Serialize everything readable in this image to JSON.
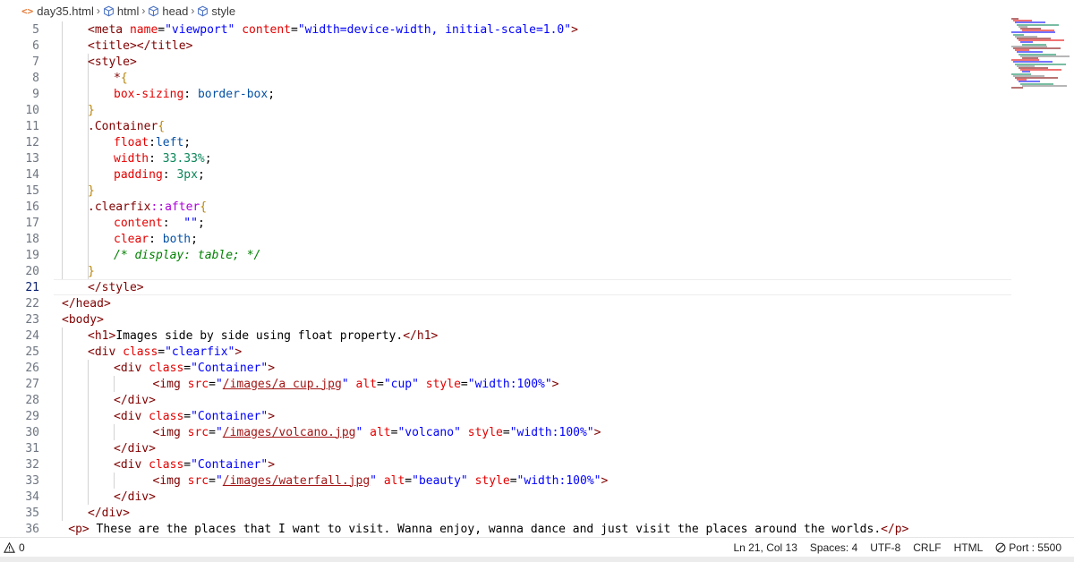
{
  "breadcrumb": {
    "file": "day35.html",
    "html": "html",
    "head": "head",
    "style": "style",
    "file_icon": "<>"
  },
  "lines": [
    {
      "n": "5",
      "tokens": [
        [
          "tag",
          "<meta "
        ],
        [
          "attr",
          "name"
        ],
        [
          "txt",
          "="
        ],
        [
          "str",
          "\"viewport\""
        ],
        [
          "txt",
          " "
        ],
        [
          "attr",
          "content"
        ],
        [
          "txt",
          "="
        ],
        [
          "str",
          "\"width=device-width, initial-scale=1.0\""
        ],
        [
          "tag",
          ">"
        ]
      ]
    },
    {
      "n": "6",
      "tokens": [
        [
          "tag",
          "<title></title>"
        ]
      ]
    },
    {
      "n": "7",
      "tokens": [
        [
          "tag",
          "<style>"
        ]
      ]
    },
    {
      "n": "8",
      "tokens": [
        [
          "sel",
          "*"
        ],
        [
          "brace",
          "{"
        ]
      ]
    },
    {
      "n": "9",
      "tokens": [
        [
          "prop",
          "box-sizing"
        ],
        [
          "txt",
          ": "
        ],
        [
          "val",
          "border-box"
        ],
        [
          "txt",
          ";"
        ]
      ]
    },
    {
      "n": "10",
      "tokens": [
        [
          "brace",
          "}"
        ]
      ]
    },
    {
      "n": "11",
      "tokens": [
        [
          "sel",
          ".Container"
        ],
        [
          "brace",
          "{"
        ]
      ]
    },
    {
      "n": "12",
      "tokens": [
        [
          "prop",
          "float"
        ],
        [
          "txt",
          ":"
        ],
        [
          "val",
          "left"
        ],
        [
          "txt",
          ";"
        ]
      ]
    },
    {
      "n": "13",
      "tokens": [
        [
          "prop",
          "width"
        ],
        [
          "txt",
          ": "
        ],
        [
          "num",
          "33.33%"
        ],
        [
          "txt",
          ";"
        ]
      ]
    },
    {
      "n": "14",
      "tokens": [
        [
          "prop",
          "padding"
        ],
        [
          "txt",
          ": "
        ],
        [
          "num",
          "3px"
        ],
        [
          "txt",
          ";"
        ]
      ]
    },
    {
      "n": "15",
      "tokens": [
        [
          "brace",
          "}"
        ]
      ]
    },
    {
      "n": "16",
      "tokens": [
        [
          "sel",
          ".clearfix"
        ],
        [
          "pseudo",
          "::after"
        ],
        [
          "brace",
          "{"
        ]
      ]
    },
    {
      "n": "17",
      "tokens": [
        [
          "prop",
          "content"
        ],
        [
          "txt",
          ":  "
        ],
        [
          "str",
          "\"\""
        ],
        [
          "txt",
          ";"
        ]
      ]
    },
    {
      "n": "18",
      "tokens": [
        [
          "prop",
          "clear"
        ],
        [
          "txt",
          ": "
        ],
        [
          "val",
          "both"
        ],
        [
          "txt",
          ";"
        ]
      ]
    },
    {
      "n": "19",
      "tokens": [
        [
          "comment",
          "/* display: table; */"
        ]
      ]
    },
    {
      "n": "20",
      "tokens": [
        [
          "brace",
          "}"
        ]
      ]
    },
    {
      "n": "21",
      "tokens": [
        [
          "tag",
          "</style>"
        ]
      ]
    },
    {
      "n": "22",
      "tokens": [
        [
          "tag",
          "</head>"
        ]
      ]
    },
    {
      "n": "23",
      "tokens": [
        [
          "tag",
          "<body>"
        ]
      ]
    },
    {
      "n": "24",
      "tokens": [
        [
          "tag",
          "<h1>"
        ],
        [
          "txt",
          "Images side by side using float property."
        ],
        [
          "tag",
          "</h1>"
        ]
      ]
    },
    {
      "n": "25",
      "tokens": [
        [
          "tag",
          "<div "
        ],
        [
          "attr",
          "class"
        ],
        [
          "txt",
          "="
        ],
        [
          "str",
          "\"clearfix\""
        ],
        [
          "tag",
          ">"
        ]
      ]
    },
    {
      "n": "26",
      "tokens": [
        [
          "tag",
          "<div "
        ],
        [
          "attr",
          "class"
        ],
        [
          "txt",
          "="
        ],
        [
          "str",
          "\"Container\""
        ],
        [
          "tag",
          ">"
        ]
      ]
    },
    {
      "n": "27",
      "tokens": [
        [
          "tag",
          "<img "
        ],
        [
          "attr",
          "src"
        ],
        [
          "txt",
          "="
        ],
        [
          "str",
          "\""
        ],
        [
          "link",
          "/images/a cup.jpg"
        ],
        [
          "str",
          "\""
        ],
        [
          "txt",
          " "
        ],
        [
          "attr",
          "alt"
        ],
        [
          "txt",
          "="
        ],
        [
          "str",
          "\"cup\""
        ],
        [
          "txt",
          " "
        ],
        [
          "attr",
          "style"
        ],
        [
          "txt",
          "="
        ],
        [
          "str",
          "\"width:100%\""
        ],
        [
          "tag",
          ">"
        ]
      ]
    },
    {
      "n": "28",
      "tokens": [
        [
          "tag",
          "</div>"
        ]
      ]
    },
    {
      "n": "29",
      "tokens": [
        [
          "tag",
          "<div "
        ],
        [
          "attr",
          "class"
        ],
        [
          "txt",
          "="
        ],
        [
          "str",
          "\"Container\""
        ],
        [
          "tag",
          ">"
        ]
      ]
    },
    {
      "n": "30",
      "tokens": [
        [
          "tag",
          "<img "
        ],
        [
          "attr",
          "src"
        ],
        [
          "txt",
          "="
        ],
        [
          "str",
          "\""
        ],
        [
          "link",
          "/images/volcano.jpg"
        ],
        [
          "str",
          "\""
        ],
        [
          "txt",
          " "
        ],
        [
          "attr",
          "alt"
        ],
        [
          "txt",
          "="
        ],
        [
          "str",
          "\"volcano\""
        ],
        [
          "txt",
          " "
        ],
        [
          "attr",
          "style"
        ],
        [
          "txt",
          "="
        ],
        [
          "str",
          "\"width:100%\""
        ],
        [
          "tag",
          ">"
        ]
      ]
    },
    {
      "n": "31",
      "tokens": [
        [
          "tag",
          "</div>"
        ]
      ]
    },
    {
      "n": "32",
      "tokens": [
        [
          "tag",
          "<div "
        ],
        [
          "attr",
          "class"
        ],
        [
          "txt",
          "="
        ],
        [
          "str",
          "\"Container\""
        ],
        [
          "tag",
          ">"
        ]
      ]
    },
    {
      "n": "33",
      "tokens": [
        [
          "tag",
          "<img "
        ],
        [
          "attr",
          "src"
        ],
        [
          "txt",
          "="
        ],
        [
          "str",
          "\""
        ],
        [
          "link",
          "/images/waterfall.jpg"
        ],
        [
          "str",
          "\""
        ],
        [
          "txt",
          " "
        ],
        [
          "attr",
          "alt"
        ],
        [
          "txt",
          "="
        ],
        [
          "str",
          "\"beauty\""
        ],
        [
          "txt",
          " "
        ],
        [
          "attr",
          "style"
        ],
        [
          "txt",
          "="
        ],
        [
          "str",
          "\"width:100%\""
        ],
        [
          "tag",
          ">"
        ]
      ]
    },
    {
      "n": "34",
      "tokens": [
        [
          "tag",
          "</div>"
        ]
      ]
    },
    {
      "n": "35",
      "tokens": [
        [
          "tag",
          "</div>"
        ]
      ]
    },
    {
      "n": "36",
      "tokens": [
        [
          "tag",
          "<p>"
        ],
        [
          "txt",
          " These are the places that I want to visit. Wanna enjoy, wanna dance and just visit the places around the worlds."
        ],
        [
          "tag",
          "</p>"
        ]
      ]
    }
  ],
  "status": {
    "problems": "0",
    "position": "Ln 21, Col 13",
    "spaces": "Spaces: 4",
    "encoding": "UTF-8",
    "eol": "CRLF",
    "language": "HTML",
    "port": "Port : 5500"
  },
  "colors": {
    "tag": "#800000",
    "attr": "#e50000",
    "string": "#0000ff",
    "number": "#098658",
    "comment": "#008000",
    "brace": "#b8860b"
  }
}
